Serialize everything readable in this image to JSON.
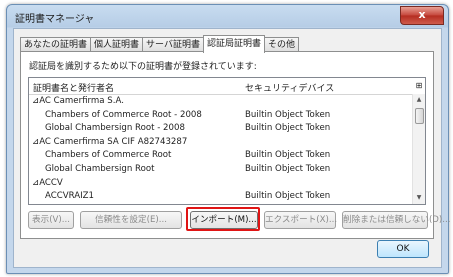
{
  "window": {
    "title": "証明書マネージャ",
    "close_symbol": "x"
  },
  "tabs": [
    {
      "label": "あなたの証明書",
      "active": false
    },
    {
      "label": "個人証明書",
      "active": false
    },
    {
      "label": "サーバ証明書",
      "active": false
    },
    {
      "label": "認証局証明書",
      "active": true
    },
    {
      "label": "その他",
      "active": false
    }
  ],
  "panel": {
    "description": "認証局を識別するため以下の証明書が登録されています:",
    "columns": {
      "name": "証明書名と発行者名",
      "device": "セキュリティデバイス",
      "picker_symbol": "⊞"
    },
    "rows": [
      {
        "kind": "group",
        "name": "⊿AC Camerfirma S.A.",
        "device": ""
      },
      {
        "kind": "child",
        "name": "Chambers of Commerce Root - 2008",
        "device": "Builtin Object Token"
      },
      {
        "kind": "child",
        "name": "Global Chambersign Root - 2008",
        "device": "Builtin Object Token"
      },
      {
        "kind": "group",
        "name": "⊿AC Camerfirma SA CIF A82743287",
        "device": ""
      },
      {
        "kind": "child",
        "name": "Chambers of Commerce Root",
        "device": "Builtin Object Token"
      },
      {
        "kind": "child",
        "name": "Global Chambersign Root",
        "device": "Builtin Object Token"
      },
      {
        "kind": "group",
        "name": "⊿ACCV",
        "device": ""
      },
      {
        "kind": "child",
        "name": "ACCVRAIZ1",
        "device": "Builtin Object Token"
      }
    ]
  },
  "buttons": {
    "view": "表示(V)...",
    "trust": "信頼性を設定(E)...",
    "import": "インポート(M)...",
    "export": "エクスポート(X)...",
    "delete": "削除または信頼しない(D)...",
    "ok": "OK"
  },
  "highlight_color": "#e01515"
}
